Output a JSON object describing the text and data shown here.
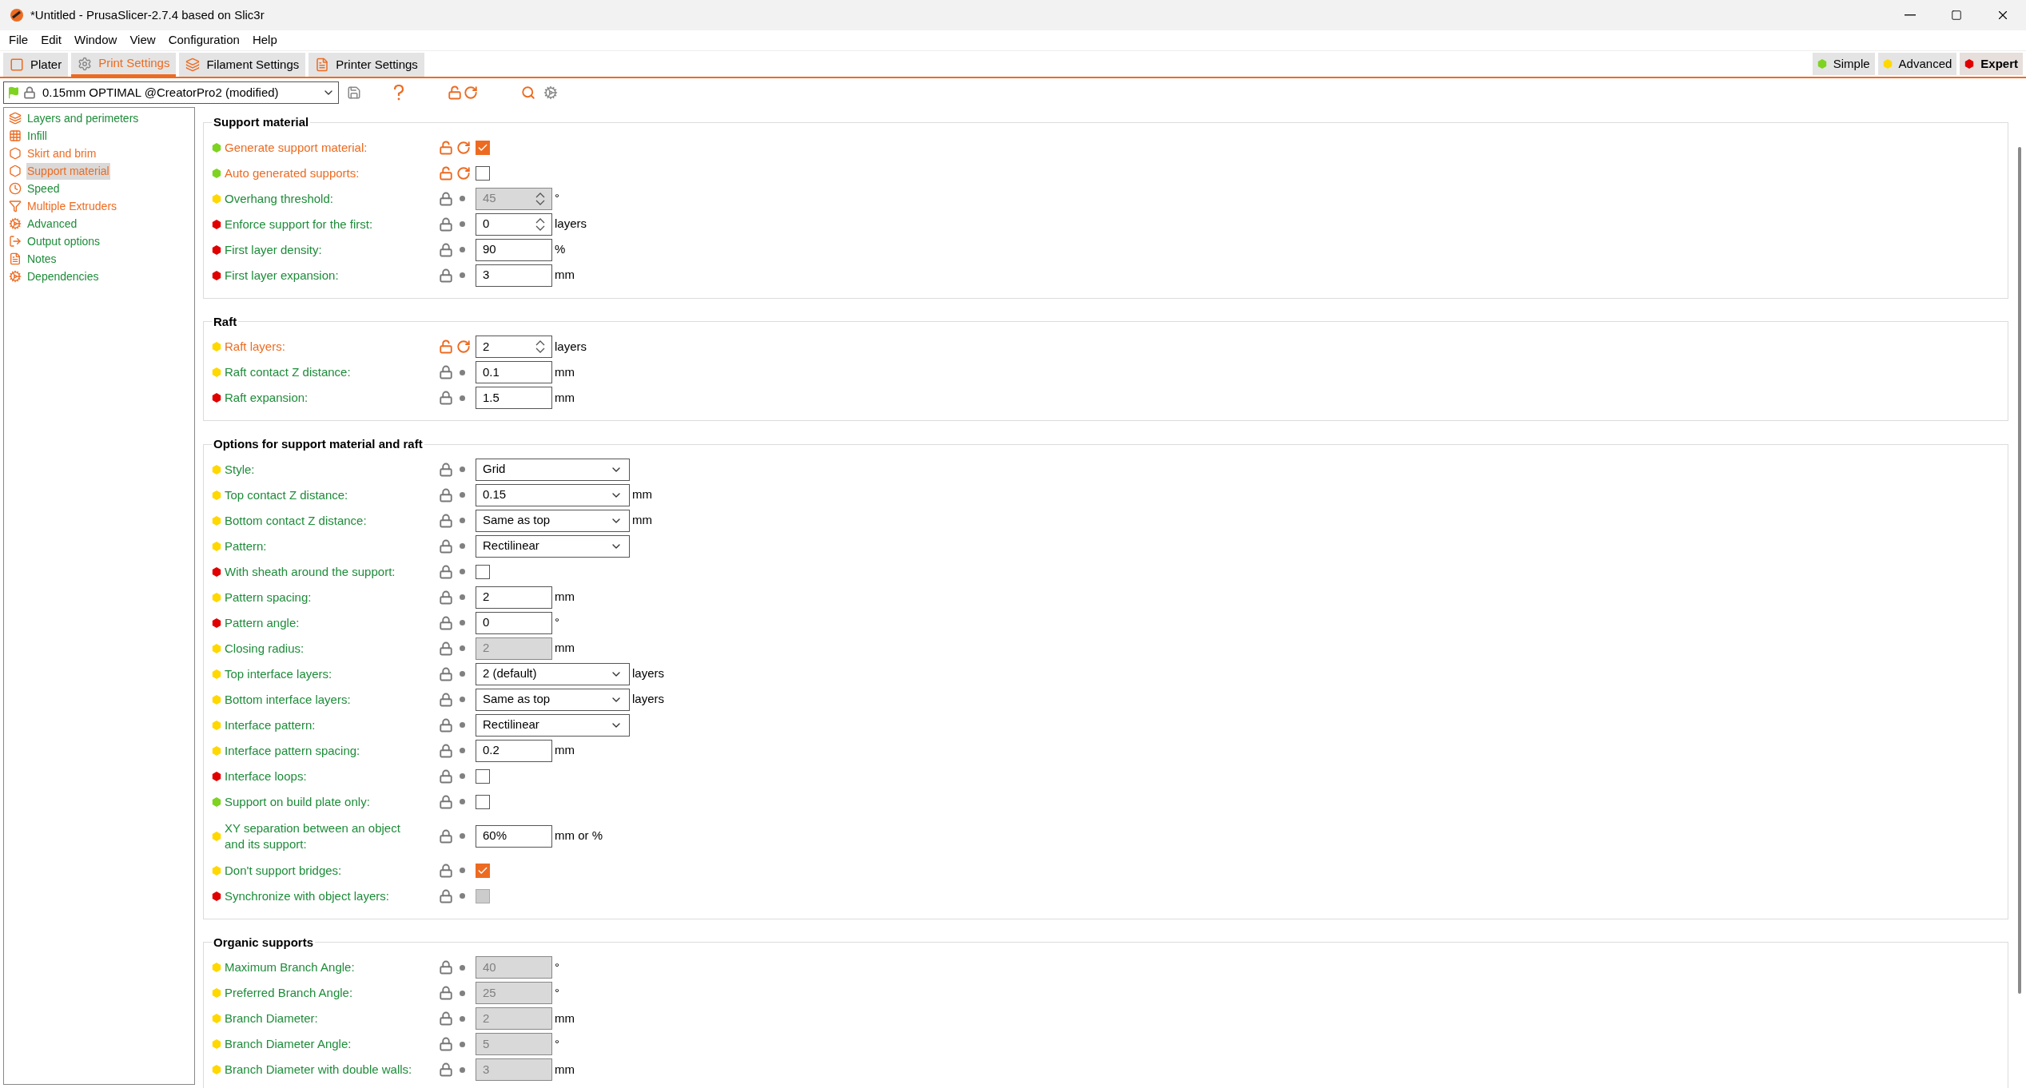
{
  "window": {
    "title": "*Untitled - PrusaSlicer-2.7.4 based on Slic3r"
  },
  "menu": [
    "File",
    "Edit",
    "Window",
    "View",
    "Configuration",
    "Help"
  ],
  "tabs": [
    {
      "label": "Plater",
      "selected": false
    },
    {
      "label": "Print Settings",
      "selected": true
    },
    {
      "label": "Filament Settings",
      "selected": false
    },
    {
      "label": "Printer Settings",
      "selected": false
    }
  ],
  "modes": [
    {
      "label": "Simple",
      "selected": false,
      "color": "#7ed321"
    },
    {
      "label": "Advanced",
      "selected": false,
      "color": "#ffd800"
    },
    {
      "label": "Expert",
      "selected": true,
      "color": "#e00000"
    }
  ],
  "preset": {
    "value": "0.15mm OPTIMAL @CreatorPro2 (modified)"
  },
  "sidebar": {
    "items": [
      {
        "label": "Layers and perimeters",
        "modified": false,
        "selected": false
      },
      {
        "label": "Infill",
        "modified": false,
        "selected": false
      },
      {
        "label": "Skirt and brim",
        "modified": true,
        "selected": false
      },
      {
        "label": "Support material",
        "modified": true,
        "selected": true
      },
      {
        "label": "Speed",
        "modified": false,
        "selected": false
      },
      {
        "label": "Multiple Extruders",
        "modified": true,
        "selected": false
      },
      {
        "label": "Advanced",
        "modified": false,
        "selected": false
      },
      {
        "label": "Output options",
        "modified": false,
        "selected": false
      },
      {
        "label": "Notes",
        "modified": false,
        "selected": false
      },
      {
        "label": "Dependencies",
        "modified": false,
        "selected": false
      }
    ]
  },
  "sections": [
    {
      "title": "Support material",
      "rows": [
        {
          "label": "Generate support material:",
          "color": "#7ed321",
          "modified": true,
          "kind": "checkbox",
          "checked": true
        },
        {
          "label": "Auto generated supports:",
          "color": "#7ed321",
          "modified": true,
          "kind": "checkbox",
          "checked": false
        },
        {
          "label": "Overhang threshold:",
          "color": "#ffd800",
          "modified": false,
          "kind": "spin",
          "value": "45",
          "disabled": true,
          "unit": "°"
        },
        {
          "label": "Enforce support for the first:",
          "color": "#e00000",
          "modified": false,
          "kind": "spin",
          "value": "0",
          "disabled": false,
          "unit": "layers"
        },
        {
          "label": "First layer density:",
          "color": "#e00000",
          "modified": false,
          "kind": "text",
          "value": "90",
          "disabled": false,
          "unit": "%"
        },
        {
          "label": "First layer expansion:",
          "color": "#e00000",
          "modified": false,
          "kind": "text",
          "value": "3",
          "disabled": false,
          "unit": "mm"
        }
      ]
    },
    {
      "title": "Raft",
      "rows": [
        {
          "label": "Raft layers:",
          "color": "#ffd800",
          "modified": true,
          "kind": "spin",
          "value": "2",
          "disabled": false,
          "unit": "layers"
        },
        {
          "label": "Raft contact Z distance:",
          "color": "#ffd800",
          "modified": false,
          "kind": "text",
          "value": "0.1",
          "disabled": false,
          "unit": "mm"
        },
        {
          "label": "Raft expansion:",
          "color": "#e00000",
          "modified": false,
          "kind": "text",
          "value": "1.5",
          "disabled": false,
          "unit": "mm"
        }
      ]
    },
    {
      "title": "Options for support material and raft",
      "rows": [
        {
          "label": "Style:",
          "color": "#ffd800",
          "modified": false,
          "kind": "select",
          "value": "Grid"
        },
        {
          "label": "Top contact Z distance:",
          "color": "#ffd800",
          "modified": false,
          "kind": "select",
          "value": "0.15",
          "unit": "mm"
        },
        {
          "label": "Bottom contact Z distance:",
          "color": "#ffd800",
          "modified": false,
          "kind": "select",
          "value": "Same as top",
          "unit": "mm"
        },
        {
          "label": "Pattern:",
          "color": "#ffd800",
          "modified": false,
          "kind": "select",
          "value": "Rectilinear"
        },
        {
          "label": "With sheath around the support:",
          "color": "#e00000",
          "modified": false,
          "kind": "checkbox",
          "checked": false
        },
        {
          "label": "Pattern spacing:",
          "color": "#ffd800",
          "modified": false,
          "kind": "text",
          "value": "2",
          "disabled": false,
          "unit": "mm"
        },
        {
          "label": "Pattern angle:",
          "color": "#e00000",
          "modified": false,
          "kind": "text",
          "value": "0",
          "disabled": false,
          "unit": "°"
        },
        {
          "label": "Closing radius:",
          "color": "#ffd800",
          "modified": false,
          "kind": "text",
          "value": "2",
          "disabled": true,
          "unit": "mm"
        },
        {
          "label": "Top interface layers:",
          "color": "#ffd800",
          "modified": false,
          "kind": "select",
          "value": "2 (default)",
          "unit": "layers"
        },
        {
          "label": "Bottom interface layers:",
          "color": "#ffd800",
          "modified": false,
          "kind": "select",
          "value": "Same as top",
          "unit": "layers"
        },
        {
          "label": "Interface pattern:",
          "color": "#ffd800",
          "modified": false,
          "kind": "select",
          "value": "Rectilinear"
        },
        {
          "label": "Interface pattern spacing:",
          "color": "#ffd800",
          "modified": false,
          "kind": "text",
          "value": "0.2",
          "disabled": false,
          "unit": "mm"
        },
        {
          "label": "Interface loops:",
          "color": "#e00000",
          "modified": false,
          "kind": "checkbox",
          "checked": false
        },
        {
          "label": "Support on build plate only:",
          "color": "#7ed321",
          "modified": false,
          "kind": "checkbox",
          "checked": false
        },
        {
          "label": "XY separation between an object and its support:",
          "color": "#ffd800",
          "modified": false,
          "kind": "text",
          "value": "60%",
          "disabled": false,
          "unit": "mm or %"
        },
        {
          "label": "Don't support bridges:",
          "color": "#ffd800",
          "modified": false,
          "kind": "checkbox",
          "checked": true
        },
        {
          "label": "Synchronize with object layers:",
          "color": "#e00000",
          "modified": false,
          "kind": "checkbox",
          "checked": false,
          "disabled": true
        }
      ]
    },
    {
      "title": "Organic supports",
      "rows": [
        {
          "label": "Maximum Branch Angle:",
          "color": "#ffd800",
          "modified": false,
          "kind": "text",
          "value": "40",
          "disabled": true,
          "unit": "°"
        },
        {
          "label": "Preferred Branch Angle:",
          "color": "#ffd800",
          "modified": false,
          "kind": "text",
          "value": "25",
          "disabled": true,
          "unit": "°"
        },
        {
          "label": "Branch Diameter:",
          "color": "#ffd800",
          "modified": false,
          "kind": "text",
          "value": "2",
          "disabled": true,
          "unit": "mm"
        },
        {
          "label": "Branch Diameter Angle:",
          "color": "#ffd800",
          "modified": false,
          "kind": "text",
          "value": "5",
          "disabled": true,
          "unit": "°"
        },
        {
          "label": "Branch Diameter with double walls:",
          "color": "#ffd800",
          "modified": false,
          "kind": "text",
          "value": "3",
          "disabled": true,
          "unit": "mm"
        }
      ]
    }
  ]
}
